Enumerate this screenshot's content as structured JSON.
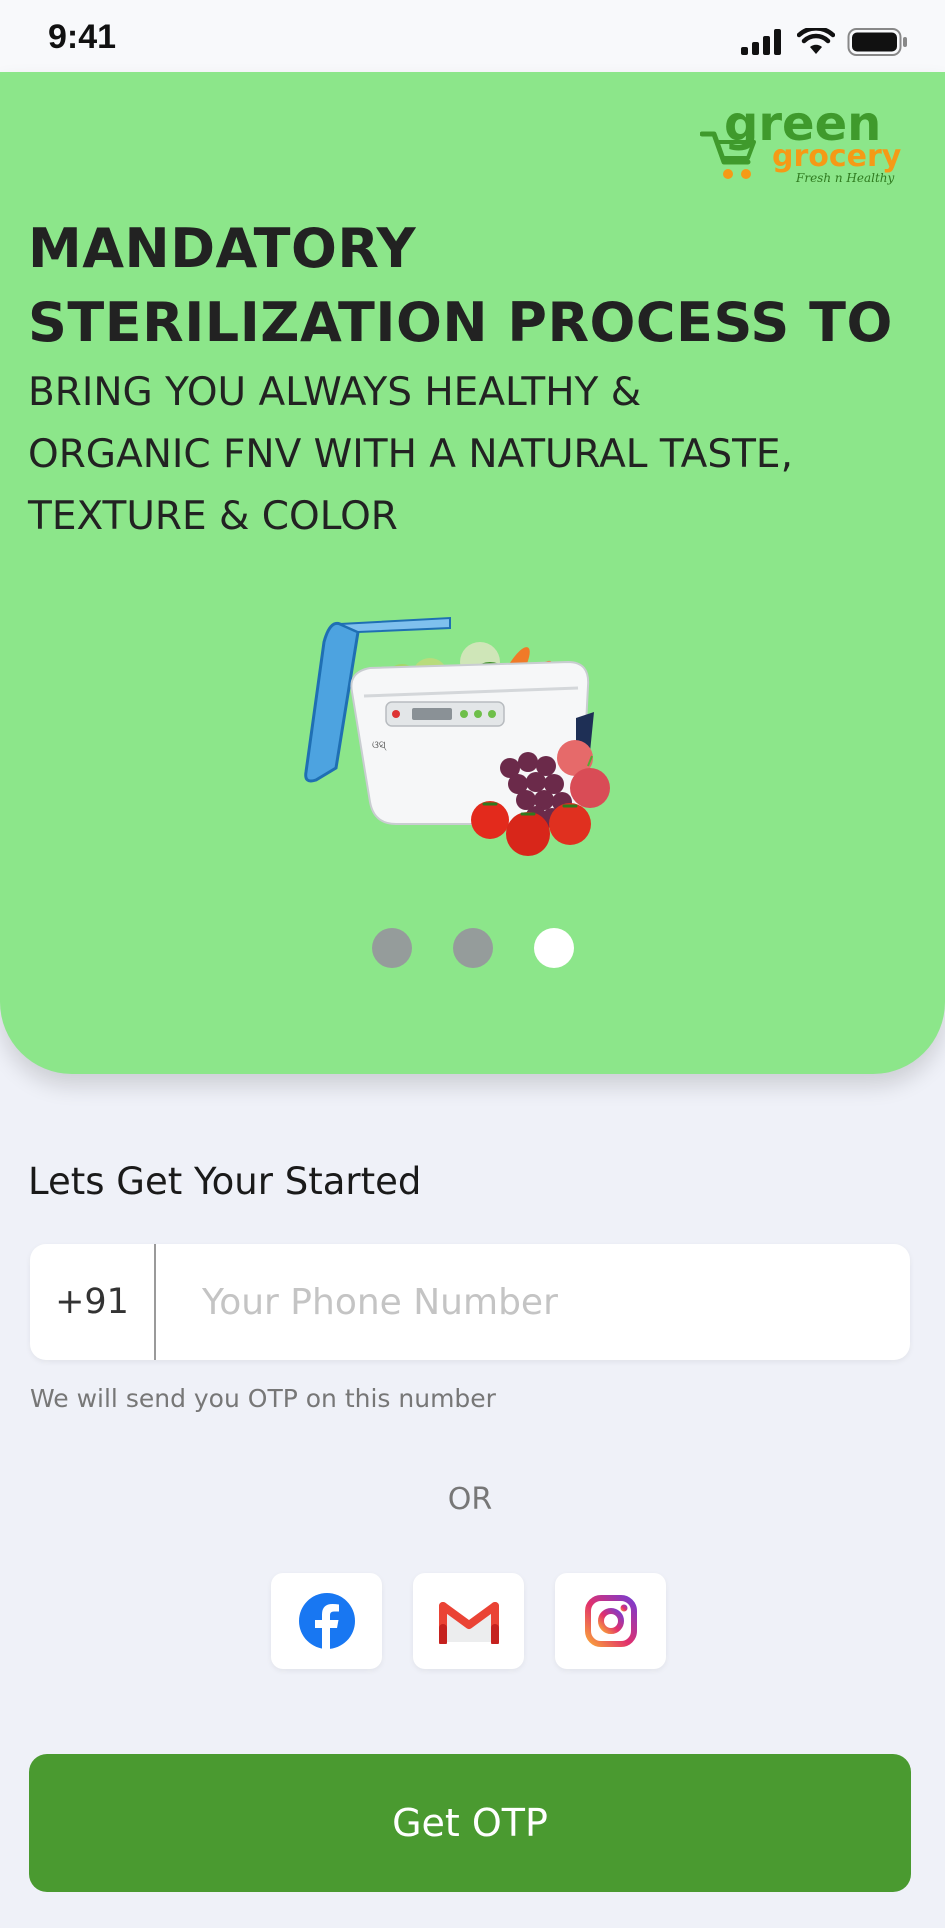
{
  "status_bar": {
    "time": "9:41",
    "icons": [
      "signal-icon",
      "wifi-icon",
      "battery-icon"
    ]
  },
  "brand": {
    "word1": "green",
    "word2": "grocery",
    "tagline": "Fresh n Healthy",
    "colors": {
      "green": "#3f9a2c",
      "orange": "#f59a16"
    }
  },
  "hero": {
    "background": "#8ce68a",
    "headline_line1": "MANDATORY",
    "headline_line2": "STERILIZATION PROCESS TO",
    "subline_line1": "BRING YOU ALWAYS HEALTHY &",
    "subline_line2": "ORGANIC FNV WITH A NATURAL TASTE,",
    "subline_line3": "TEXTURE & COLOR",
    "product_label": "ଓସ୍",
    "carousel": {
      "total": 3,
      "active_index": 2
    }
  },
  "form": {
    "title": "Lets Get Your Started",
    "country_code": "+91",
    "phone_placeholder": "Your Phone Number",
    "phone_value": "",
    "hint": "We will send you OTP on this number",
    "or_label": "OR"
  },
  "socials": [
    {
      "name": "facebook",
      "icon": "facebook-icon",
      "color": "#1877f2"
    },
    {
      "name": "gmail",
      "icon": "gmail-icon",
      "color": "#ea4335"
    },
    {
      "name": "instagram",
      "icon": "instagram-icon",
      "color": "#c13584"
    }
  ],
  "cta": {
    "label": "Get OTP",
    "color": "#4a9a30"
  }
}
